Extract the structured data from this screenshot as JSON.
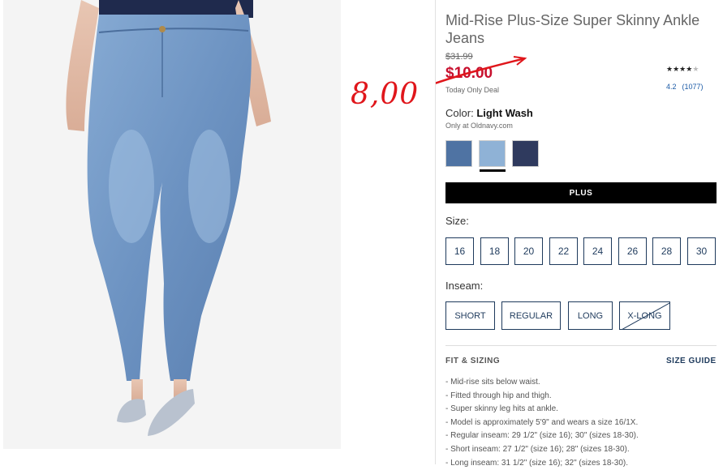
{
  "product": {
    "title": "Mid-Rise Plus-Size Super Skinny Ankle Jeans",
    "original_price": "$31.99",
    "sale_price": "$10.00",
    "deal_text": "Today Only Deal",
    "handwritten_price": "8,00",
    "rating": {
      "stars": 4,
      "max": 5,
      "value": "4.2",
      "count": "(1077)"
    }
  },
  "color": {
    "label": "Color:",
    "selected": "Light Wash",
    "availability": "Only at Oldnavy.com",
    "swatches": [
      {
        "name": "medium-wash",
        "color": "#4f73a3"
      },
      {
        "name": "light-wash",
        "color": "#8fb2d6",
        "selected": true
      },
      {
        "name": "dark-wash",
        "color": "#2f3a5e"
      }
    ]
  },
  "fit_type": {
    "selected": "PLUS"
  },
  "size": {
    "label": "Size:",
    "options": [
      "16",
      "18",
      "20",
      "22",
      "24",
      "26",
      "28",
      "30"
    ]
  },
  "inseam": {
    "label": "Inseam:",
    "options": [
      {
        "label": "SHORT",
        "available": true
      },
      {
        "label": "REGULAR",
        "available": true
      },
      {
        "label": "LONG",
        "available": true
      },
      {
        "label": "X-LONG",
        "available": false
      }
    ]
  },
  "fit_sizing": {
    "heading": "FIT & SIZING",
    "guide_link": "SIZE GUIDE",
    "bullets": [
      "Mid-rise sits below waist.",
      "Fitted through hip and thigh.",
      "Super skinny leg hits at ankle.",
      "Model is approximately 5'9\" and wears a size 16/1X.",
      "Regular inseam: 29 1/2\" (size 16); 30\" (sizes 18-30).",
      "Short inseam: 27 1/2\" (size 16); 28\" (sizes 18-30).",
      "Long inseam: 31 1/2\" (size 16); 32\" (sizes 18-30)."
    ]
  },
  "colors": {
    "accent": "#1e3a5c",
    "sale": "#c8102e",
    "annotation": "#e0161b"
  }
}
